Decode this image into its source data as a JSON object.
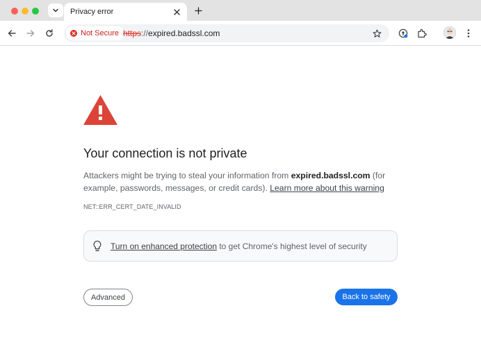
{
  "window": {
    "traffic_lights": [
      "close",
      "minimize",
      "zoom"
    ]
  },
  "tabs": [
    {
      "title": "Privacy error",
      "active": true
    }
  ],
  "toolbar": {
    "back_icon": "arrow-left-icon",
    "forward_icon": "arrow-right-icon",
    "reload_icon": "reload-icon",
    "security_chip_label": "Not Secure",
    "url_scheme": "https",
    "url_separator": "://",
    "url_host": "expired.badssl.com",
    "bookmark_icon": "star-icon",
    "extension_icons": [
      "password-manager-icon",
      "extensions-puzzle-icon"
    ],
    "menu_icon": "kebab-menu-icon"
  },
  "interstitial": {
    "heading": "Your connection is not private",
    "explanation_prefix": "Attackers might be trying to steal your information from ",
    "explanation_host": "expired.badssl.com",
    "explanation_suffix": " (for example, passwords, messages, or credit cards). ",
    "learn_more_link": "Learn more about this warning",
    "error_code": "NET::ERR_CERT_DATE_INVALID",
    "enhanced_link": "Turn on enhanced protection",
    "enhanced_suffix": " to get Chrome's highest level of security",
    "advanced_button": "Advanced",
    "back_button": "Back to safety"
  },
  "colors": {
    "warning_red": "#db4437",
    "not_secure_red": "#d93025",
    "primary_blue": "#1a73e8"
  }
}
